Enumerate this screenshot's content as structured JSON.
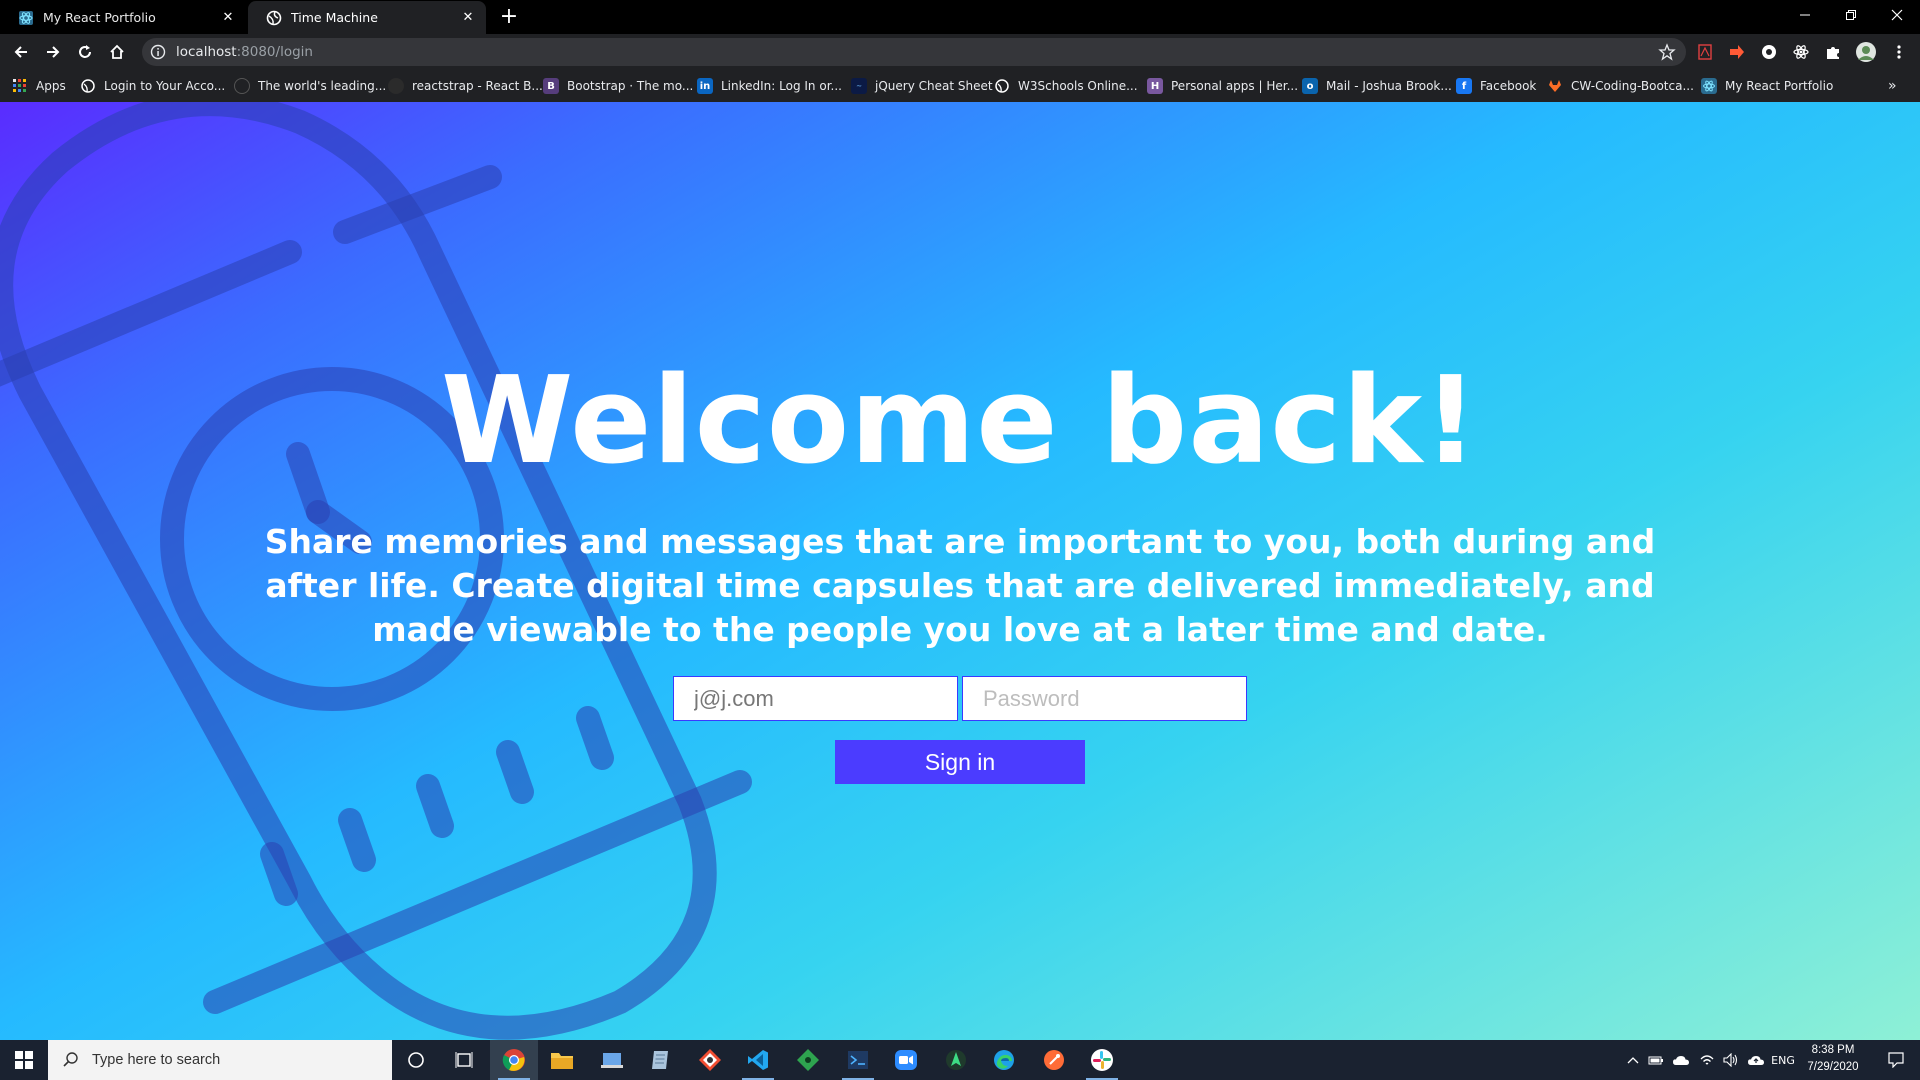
{
  "browser": {
    "tabs": [
      {
        "title": "My React Portfolio",
        "active": false
      },
      {
        "title": "Time Machine",
        "active": true
      }
    ],
    "url": {
      "host": "localhost",
      "path": ":8080/login"
    },
    "bookmarks": [
      {
        "label": "Apps",
        "icon": "apps-grid-icon"
      },
      {
        "label": "Login to Your Acco...",
        "icon": "globe-icon"
      },
      {
        "label": "The world's leading...",
        "icon": "github-icon"
      },
      {
        "label": "reactstrap - React B...",
        "icon": "reactstrap-icon"
      },
      {
        "label": "Bootstrap · The mo...",
        "icon": "bootstrap-icon"
      },
      {
        "label": "LinkedIn: Log In or...",
        "icon": "linkedin-icon"
      },
      {
        "label": "jQuery Cheat Sheet",
        "icon": "jquery-icon"
      },
      {
        "label": "W3Schools Online...",
        "icon": "globe-icon"
      },
      {
        "label": "Personal apps | Her...",
        "icon": "heroku-icon"
      },
      {
        "label": "Mail - Joshua Brook...",
        "icon": "outlook-icon"
      },
      {
        "label": "Facebook",
        "icon": "facebook-icon"
      },
      {
        "label": "CW-Coding-Bootca...",
        "icon": "gitlab-icon"
      },
      {
        "label": "My React Portfolio",
        "icon": "react-icon"
      }
    ]
  },
  "page": {
    "heading": "Welcome back!",
    "tagline": "Share memories and messages that are important to you, both during and after life. Create digital time capsules that are delivered immediately, and made viewable to the people you love at a later time and date.",
    "email": {
      "value": "j@j.com",
      "placeholder": ""
    },
    "password": {
      "value": "",
      "placeholder": "Password"
    },
    "signin_label": "Sign in"
  },
  "taskbar": {
    "search_placeholder": "Type here to search",
    "language": "ENG",
    "time": "8:38 PM",
    "date": "7/29/2020"
  },
  "colors": {
    "accent": "#4b3cff",
    "gradient_start": "#5a2cff",
    "gradient_mid": "#25baff",
    "gradient_end": "#8ef0d6"
  }
}
